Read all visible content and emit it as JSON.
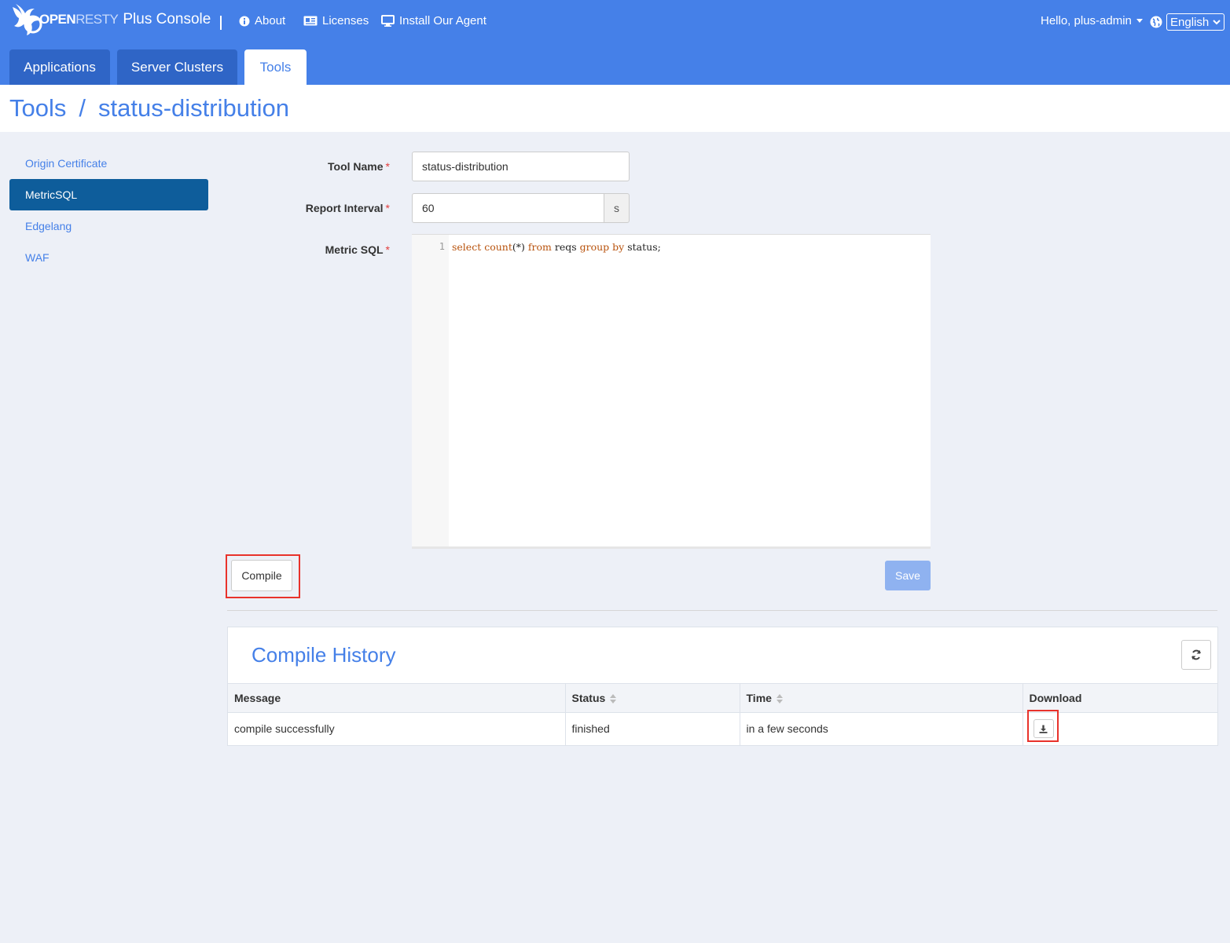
{
  "header": {
    "brand_open": "OPEN",
    "brand_resty": "RESTY",
    "brand_console": "Plus Console",
    "nav": [
      {
        "label": "About",
        "icon": "info-icon"
      },
      {
        "label": "Licenses",
        "icon": "id-card-icon"
      },
      {
        "label": "Install Our Agent",
        "icon": "monitor-icon"
      }
    ],
    "user_greeting": "Hello, plus-admin",
    "language": "English"
  },
  "tabs": [
    {
      "label": "Applications",
      "active": false
    },
    {
      "label": "Server Clusters",
      "active": false
    },
    {
      "label": "Tools",
      "active": true
    }
  ],
  "breadcrumb": {
    "root": "Tools",
    "separator": "/",
    "current": "status-distribution"
  },
  "sidebar": {
    "items": [
      {
        "label": "Origin Certificate",
        "active": false
      },
      {
        "label": "MetricSQL",
        "active": true
      },
      {
        "label": "Edgelang",
        "active": false
      },
      {
        "label": "WAF",
        "active": false
      }
    ]
  },
  "form": {
    "tool_name_label": "Tool Name",
    "tool_name_value": "status-distribution",
    "report_interval_label": "Report Interval",
    "report_interval_value": "60",
    "report_interval_unit": "s",
    "metricsql_label": "Metric SQL",
    "required_mark": "*",
    "editor": {
      "line_number": "1",
      "tokens": {
        "select": "select",
        "count": "count",
        "paren": "(*)",
        "from": "from",
        "table": "reqs",
        "group": "group",
        "by": "by",
        "field": "status;"
      }
    },
    "compile_label": "Compile",
    "save_label": "Save"
  },
  "history": {
    "title": "Compile History",
    "columns": [
      "Message",
      "Status",
      "Time",
      "Download"
    ],
    "rows": [
      {
        "message": "compile successfully",
        "status": "finished",
        "time": "in a few seconds"
      }
    ]
  },
  "colors": {
    "header_bg": "#4580e8",
    "tab_bg": "#2f65c6",
    "sidebar_active": "#0e5d9b",
    "highlight": "#e8322b"
  }
}
